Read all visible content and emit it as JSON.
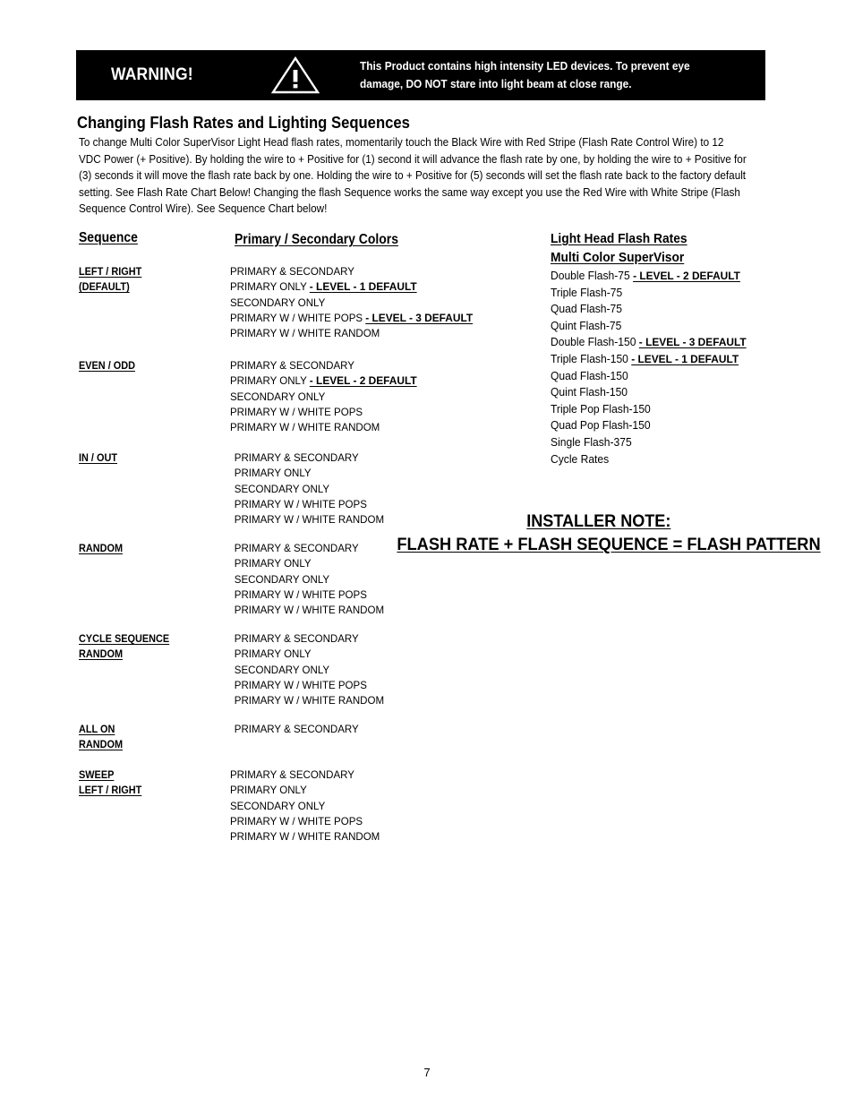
{
  "warning": {
    "label": "WARNING!",
    "icon": "warning-triangle-icon",
    "message": "This  Product  contains  high  intensity LED devices.  To  prevent  eye\ndamage, DO  NOT  stare  into  light  beam  at  close  range.",
    "bg_color": "#000000",
    "fg_color": "#FFFFFF"
  },
  "section": {
    "heading": "Changing Flash Rates and Lighting Sequences",
    "paragraph": "To change Multi Color SuperVisor Light Head flash rates, momentarily touch the Black Wire with Red Stripe (Flash Rate Control Wire) to 12 VDC Power (+ Positive). By holding the wire to + Positive for (1) second it will advance the flash rate by one, by holding the wire to + Positive for (3) seconds it will move the flash rate back by one. Holding the wire to + Positive for (5) seconds will set the flash rate back to the factory default setting. See Flash Rate Chart Below! Changing the flash Sequence works the same way except you use the Red Wire with White Stripe (Flash Sequence Control Wire). See Sequence Chart below!"
  },
  "sequence_table": {
    "header_sequence": "Sequence",
    "header_colors": "Primary / Secondary Colors",
    "rows": [
      {
        "label_lines": [
          "LEFT / RIGHT",
          "(DEFAULT)"
        ],
        "indented": false,
        "options": [
          {
            "text": "PRIMARY & SECONDARY",
            "level": ""
          },
          {
            "text": "PRIMARY ONLY ",
            "level": "- LEVEL - 1 DEFAULT"
          },
          {
            "text": "SECONDARY ONLY",
            "level": ""
          },
          {
            "text": "PRIMARY W / WHITE POPS ",
            "level": "- LEVEL - 3 DEFAULT"
          },
          {
            "text": "PRIMARY W / WHITE RANDOM",
            "level": ""
          }
        ]
      },
      {
        "label_lines": [
          "EVEN / ODD"
        ],
        "indented": false,
        "options": [
          {
            "text": "PRIMARY & SECONDARY",
            "level": ""
          },
          {
            "text": "PRIMARY ONLY ",
            "level": "- LEVEL - 2 DEFAULT"
          },
          {
            "text": "SECONDARY ONLY",
            "level": ""
          },
          {
            "text": "PRIMARY W / WHITE POPS",
            "level": ""
          },
          {
            "text": "PRIMARY W / WHITE RANDOM",
            "level": ""
          }
        ]
      },
      {
        "label_lines": [
          "IN / OUT"
        ],
        "indented": true,
        "options": [
          {
            "text": "PRIMARY & SECONDARY",
            "level": ""
          },
          {
            "text": "PRIMARY ONLY",
            "level": ""
          },
          {
            "text": "SECONDARY ONLY",
            "level": ""
          },
          {
            "text": "PRIMARY W / WHITE POPS",
            "level": ""
          },
          {
            "text": "PRIMARY W / WHITE RANDOM",
            "level": ""
          }
        ]
      },
      {
        "label_lines": [
          "RANDOM"
        ],
        "indented": true,
        "options": [
          {
            "text": "PRIMARY & SECONDARY",
            "level": ""
          },
          {
            "text": "PRIMARY ONLY",
            "level": ""
          },
          {
            "text": "SECONDARY ONLY",
            "level": ""
          },
          {
            "text": "PRIMARY W / WHITE POPS",
            "level": ""
          },
          {
            "text": "PRIMARY W / WHITE RANDOM",
            "level": ""
          }
        ]
      },
      {
        "label_lines": [
          "CYCLE SEQUENCE",
          "RANDOM"
        ],
        "indented": true,
        "options": [
          {
            "text": "PRIMARY & SECONDARY",
            "level": ""
          },
          {
            "text": "PRIMARY ONLY",
            "level": ""
          },
          {
            "text": "SECONDARY ONLY",
            "level": ""
          },
          {
            "text": "PRIMARY W / WHITE POPS",
            "level": ""
          },
          {
            "text": "PRIMARY W / WHITE RANDOM",
            "level": ""
          }
        ]
      },
      {
        "label_lines": [
          "ALL ON",
          "RANDOM"
        ],
        "indented": true,
        "options": [
          {
            "text": "PRIMARY & SECONDARY",
            "level": ""
          }
        ]
      },
      {
        "label_lines": [
          "SWEEP",
          "LEFT / RIGHT"
        ],
        "indented": false,
        "options": [
          {
            "text": "PRIMARY & SECONDARY",
            "level": ""
          },
          {
            "text": "PRIMARY ONLY",
            "level": ""
          },
          {
            "text": "SECONDARY ONLY",
            "level": ""
          },
          {
            "text": "PRIMARY W / WHITE POPS",
            "level": ""
          },
          {
            "text": "PRIMARY W / WHITE RANDOM",
            "level": ""
          }
        ]
      }
    ]
  },
  "flash_rates": {
    "heading_lines": [
      "Light Head Flash Rates",
      "Multi Color SuperVisor"
    ],
    "items": [
      {
        "text": "Double Flash-75 ",
        "level": "- LEVEL - 2 DEFAULT"
      },
      {
        "text": "Triple Flash-75",
        "level": ""
      },
      {
        "text": "Quad Flash-75",
        "level": ""
      },
      {
        "text": "Quint Flash-75",
        "level": ""
      },
      {
        "text": "Double Flash-150 ",
        "level": "- LEVEL - 3 DEFAULT"
      },
      {
        "text": "Triple Flash-150 ",
        "level": "- LEVEL - 1 DEFAULT"
      },
      {
        "text": "Quad Flash-150",
        "level": ""
      },
      {
        "text": "Quint Flash-150",
        "level": ""
      },
      {
        "text": "Triple Pop Flash-150",
        "level": ""
      },
      {
        "text": "Quad Pop Flash-150",
        "level": ""
      },
      {
        "text": "Single Flash-375",
        "level": ""
      },
      {
        "text": "Cycle Rates",
        "level": ""
      }
    ]
  },
  "installer_note": {
    "title": "INSTALLER NOTE:",
    "formula": "FLASH RATE + FLASH SEQUENCE = FLASH PATTERN"
  },
  "footer": {
    "page_number": "7"
  }
}
